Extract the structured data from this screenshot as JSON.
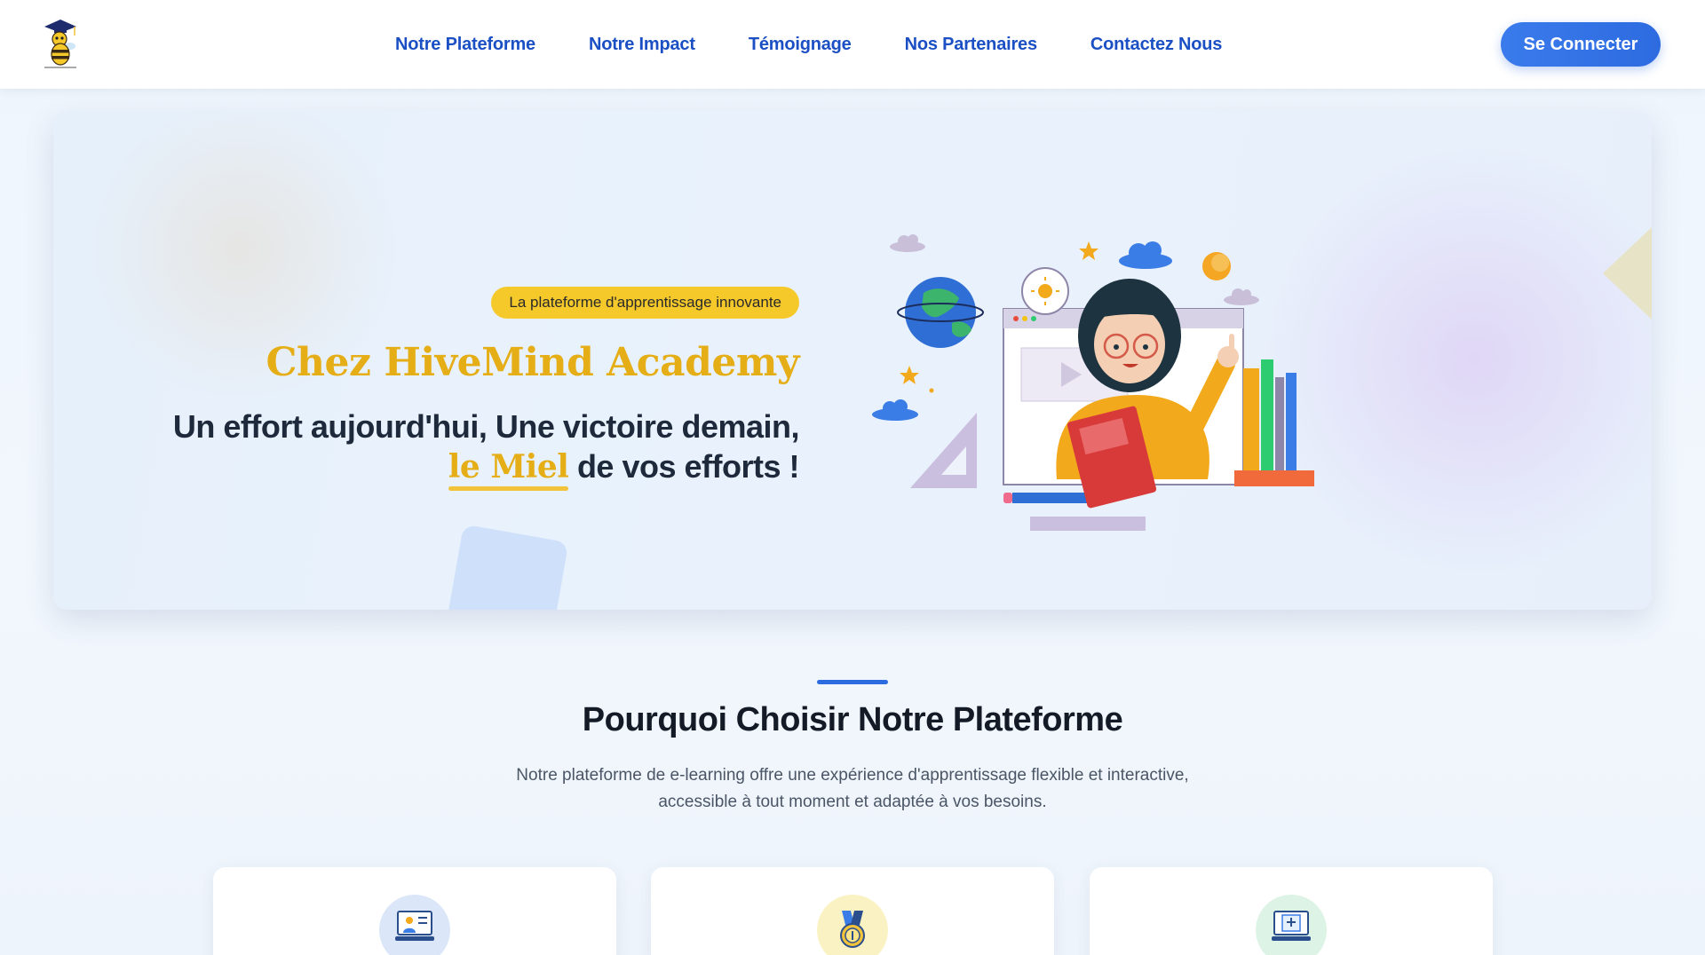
{
  "nav": {
    "links": [
      {
        "label": "Notre Plateforme"
      },
      {
        "label": "Notre Impact"
      },
      {
        "label": "Témoignage"
      },
      {
        "label": "Nos Partenaires"
      },
      {
        "label": "Contactez Nous"
      }
    ],
    "login_label": "Se Connecter"
  },
  "hero": {
    "badge": "La plateforme d'apprentissage innovante",
    "title": "Chez HiveMind Academy",
    "tagline_line1": "Un effort aujourd'hui, Une victoire demain,",
    "tagline_highlight": "le Miel",
    "tagline_end": " de vos efforts !"
  },
  "why": {
    "title": "Pourquoi Choisir Notre Plateforme",
    "description_line1": "Notre plateforme de e-learning offre une expérience d'apprentissage flexible et interactive,",
    "description_line2": "accessible à tout moment et adaptée à vos besoins."
  },
  "cards": [
    {
      "icon": "teacher-screen-icon"
    },
    {
      "icon": "medal-icon"
    },
    {
      "icon": "online-certificate-icon"
    }
  ],
  "colors": {
    "brand_blue": "#2d6be0",
    "nav_link": "#1b4fc4",
    "honey_yellow": "#e5ae16",
    "badge_yellow": "#f6c92b"
  }
}
